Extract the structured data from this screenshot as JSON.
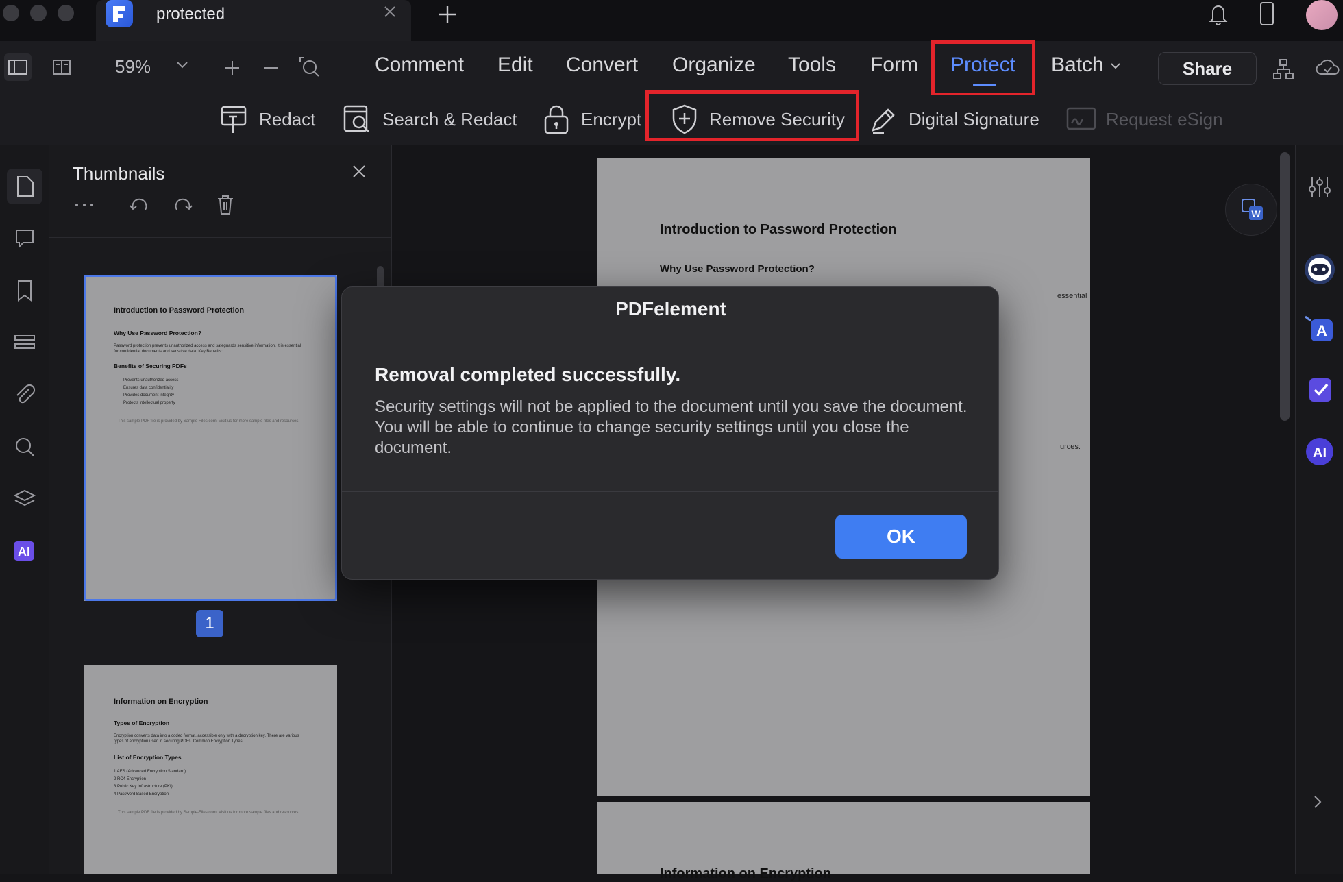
{
  "tab": {
    "title": "protected"
  },
  "toolbar": {
    "zoom": "59%",
    "menus": [
      "Comment",
      "Edit",
      "Convert",
      "Organize",
      "Tools",
      "Form",
      "Protect",
      "Batch"
    ],
    "active_menu": "Protect",
    "share_label": "Share"
  },
  "protect_tools": [
    "Redact",
    "Search & Redact",
    "Encrypt",
    "Remove Security",
    "Digital Signature",
    "Request eSign"
  ],
  "thumbnails": {
    "title": "Thumbnails",
    "page_badge": "1",
    "pages": [
      {
        "title": "Introduction to Password Protection",
        "subtitle": "Why Use Password Protection?",
        "text": "Password protection prevents unauthorized access and safeguards sensitive information. It is essential for confidential documents and sensitive data. Key Benefits:",
        "section": "Benefits of Securing PDFs",
        "bullets": [
          "Prevents unauthorized access",
          "Ensures data confidentiality",
          "Provides document integrity",
          "Protects intellectual property"
        ],
        "footer": "This sample PDF file is provided by Sample-Files.com. Visit us for more sample files and resources."
      },
      {
        "title": "Information on Encryption",
        "subtitle": "Types of Encryption",
        "text": "Encryption converts data into a coded format, accessible only with a decryption key. There are various types of encryption used in securing PDFs. Common Encryption Types:",
        "section": "List of Encryption Types",
        "bullets": [
          "1  AES (Advanced Encryption Standard)",
          "2  RC4 Encryption",
          "3  Public Key Infrastructure (PKI)",
          "4  Password Based Encryption"
        ],
        "footer": "This sample PDF file is provided by Sample-Files.com. Visit us for more sample files and resources."
      }
    ]
  },
  "document": {
    "page1_title": "Introduction to Password Protection",
    "page1_subtitle": "Why Use Password Protection?",
    "page1_fragment": "essential",
    "page1_fragment2": "urces.",
    "page2_title": "Information on Encryption"
  },
  "dialog": {
    "title": "PDFelement",
    "heading": "Removal completed successfully.",
    "body": "Security settings will not be applied to the document until you save the document. You will be able to continue to change security settings until you close the document.",
    "ok_label": "OK"
  },
  "colors": {
    "accent": "#5d8dff",
    "highlight": "#e3242b",
    "ok_button": "#3f7df2"
  }
}
